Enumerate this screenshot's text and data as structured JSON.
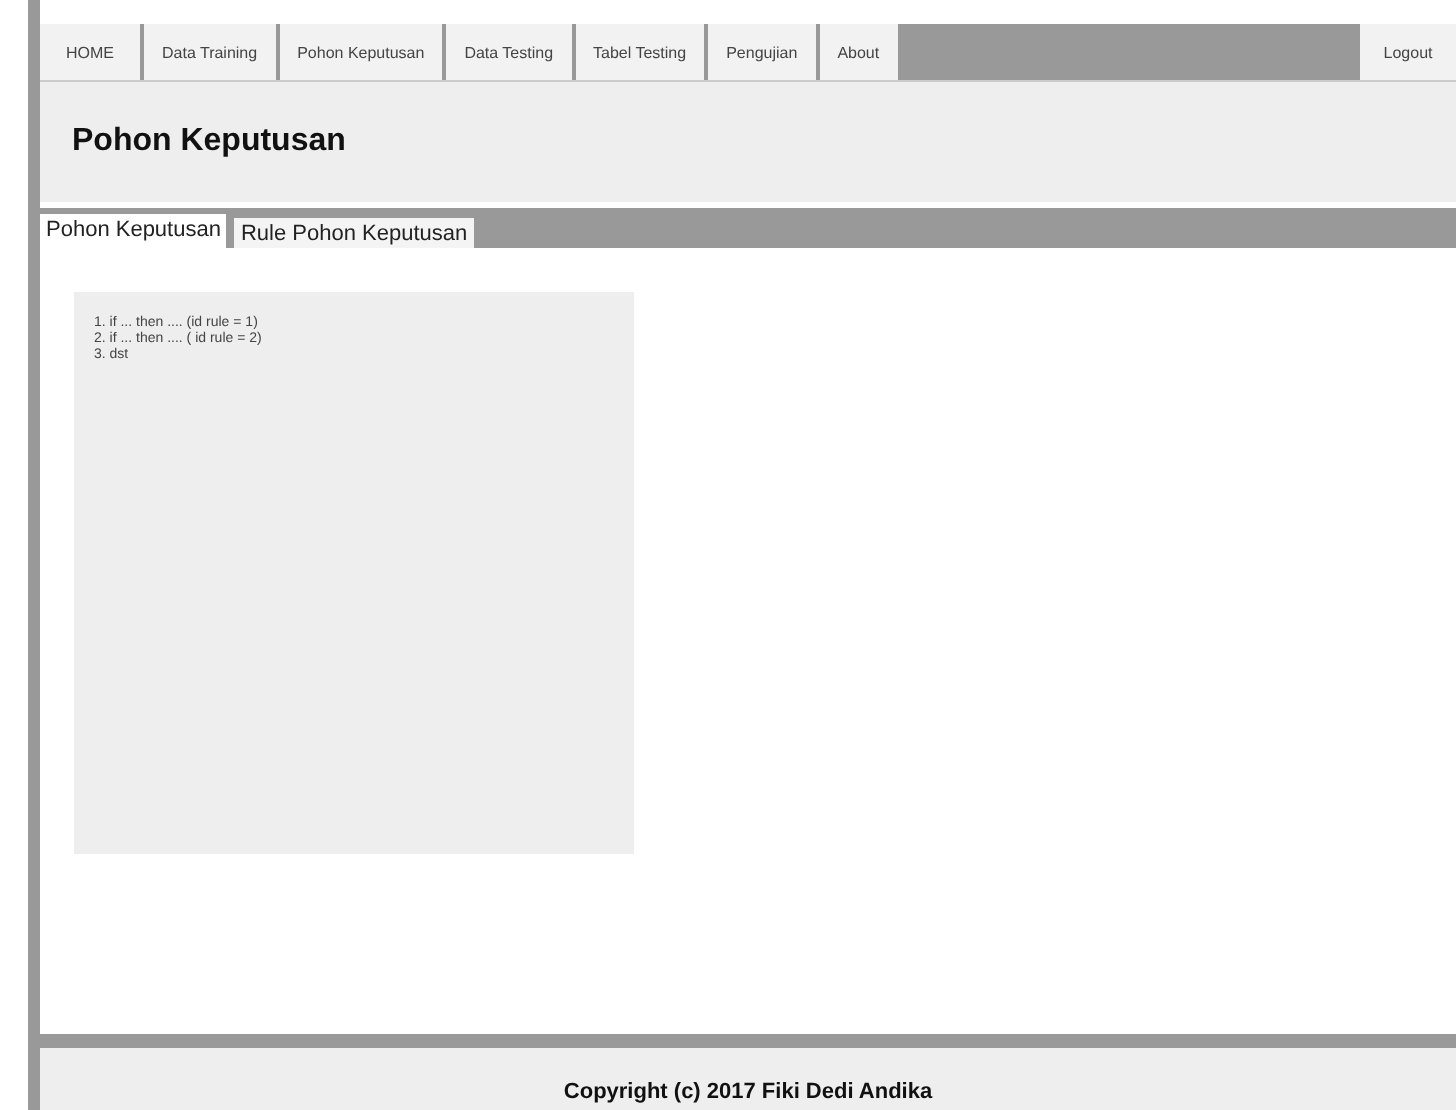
{
  "nav": {
    "items": [
      "HOME",
      "Data Training",
      "Pohon Keputusan",
      "Data Testing",
      "Tabel Testing",
      "Pengujian",
      "About"
    ],
    "logout": "Logout"
  },
  "header": {
    "title": "Pohon Keputusan"
  },
  "tabs": [
    {
      "label": "Pohon Keputusan",
      "selected": true
    },
    {
      "label": "Rule Pohon Keputusan",
      "selected": false
    }
  ],
  "rules": [
    "1. if ... then .... (id rule = 1)",
    "2. if ... then .... ( id rule = 2)",
    "3. dst"
  ],
  "footer": {
    "text": "Copyright (c) 2017 Fiki Dedi Andika"
  }
}
